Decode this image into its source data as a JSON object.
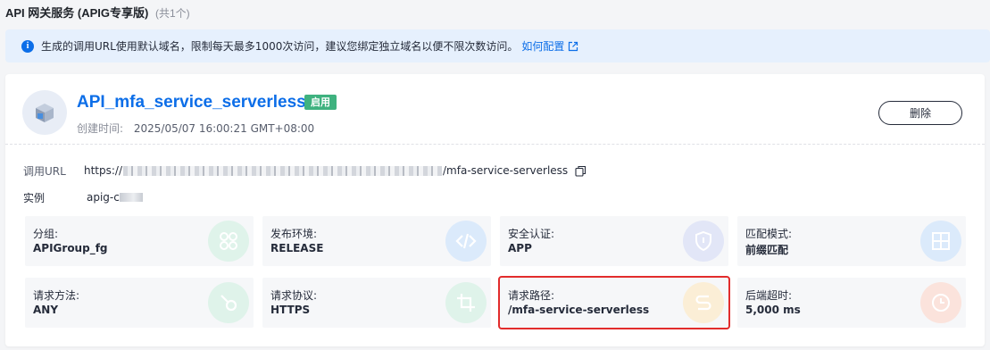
{
  "header": {
    "title": "API 网关服务 (APIG专享版)",
    "count": "(共1个)"
  },
  "notice": {
    "text": "生成的调用URL使用默认域名，限制每天最多1000次访问，建议您绑定独立域名以便不限次数访问。",
    "link": "如何配置"
  },
  "service": {
    "name": "API_mfa_service_serverless",
    "status": "启用",
    "created_label": "创建时间:",
    "created_value": "2025/05/07 16:00:21 GMT+08:00",
    "delete_label": "删除"
  },
  "url_row": {
    "label": "调用URL",
    "prefix": "https://",
    "suffix": "/mfa-service-serverless"
  },
  "instance_row": {
    "label": "实例",
    "value_prefix": "apig-c"
  },
  "tiles": [
    {
      "label": "分组:",
      "value": "APIGroup_fg",
      "icon": "group-icon",
      "color": "#3fb27f"
    },
    {
      "label": "发布环境:",
      "value": "RELEASE",
      "icon": "code-icon",
      "color": "#3b8ce6"
    },
    {
      "label": "安全认证:",
      "value": "APP",
      "icon": "shield-icon",
      "color": "#6a7ccf"
    },
    {
      "label": "匹配模式:",
      "value": "前缀匹配",
      "icon": "match-prefix-icon",
      "color": "#3b8ce6"
    },
    {
      "label": "请求方法:",
      "value": "ANY",
      "icon": "method-icon",
      "color": "#3fb27f"
    },
    {
      "label": "请求协议:",
      "value": "HTTPS",
      "icon": "crop-icon",
      "color": "#3fb27f"
    },
    {
      "label": "请求路径:",
      "value": "/mfa-service-serverless",
      "icon": "route-icon",
      "color": "#f0b232"
    },
    {
      "label": "后端超时:",
      "value": "5,000 ms",
      "icon": "clock-icon",
      "color": "#e8775a"
    }
  ],
  "colors": {
    "accent": "#0c6ee8",
    "status_green": "#3fb27f",
    "highlight_border": "#e22c2c"
  }
}
